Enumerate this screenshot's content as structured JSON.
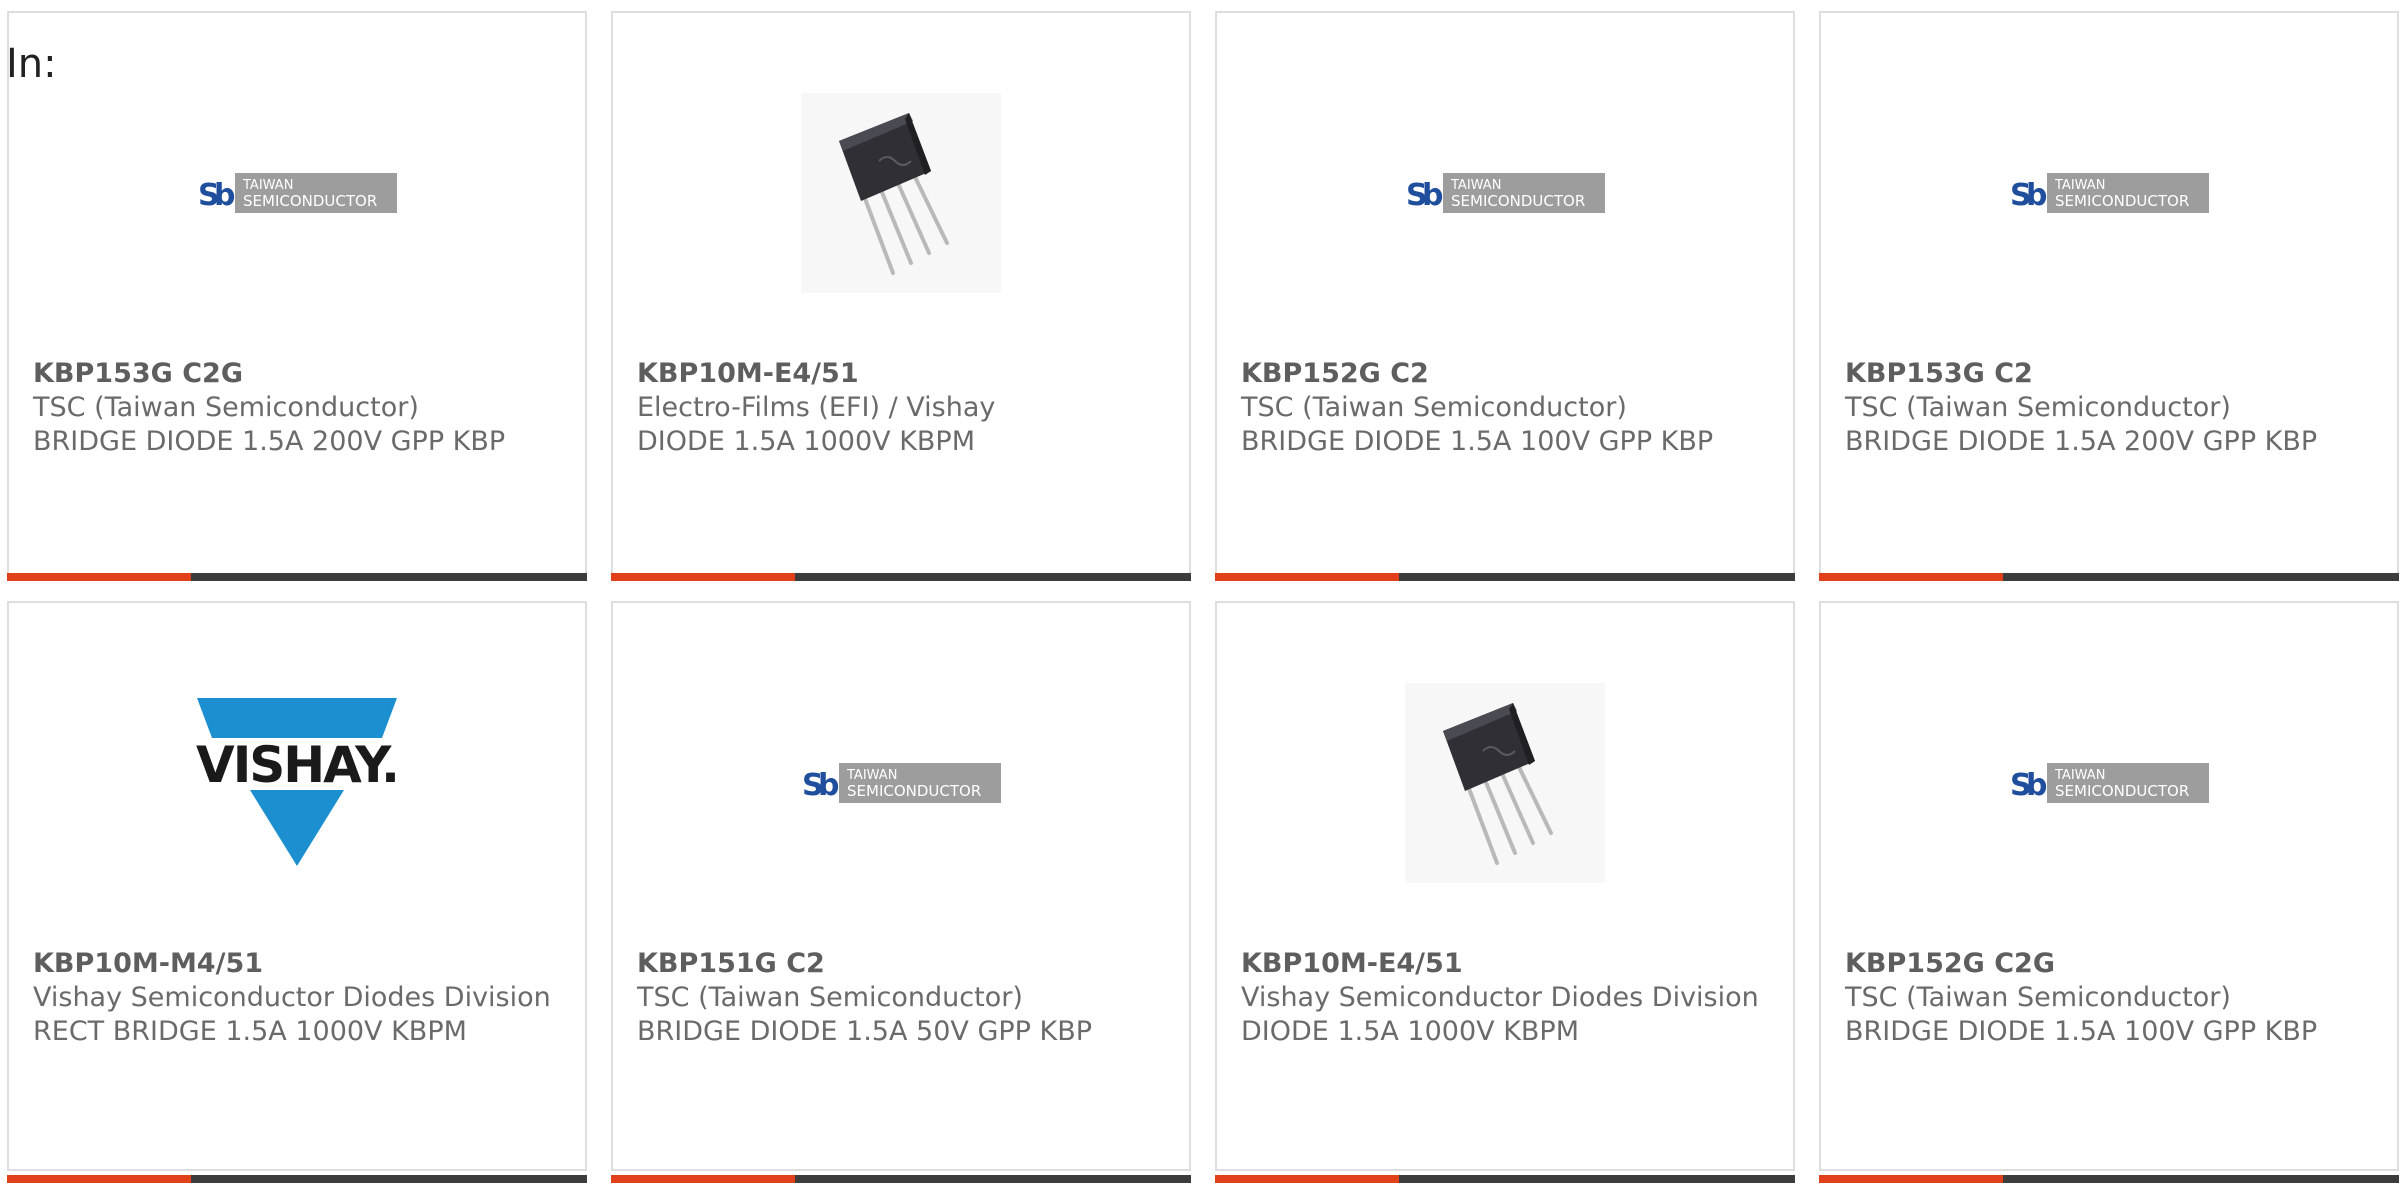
{
  "heading": "In:",
  "products": [
    {
      "part_number": "KBP153G C2G",
      "manufacturer": "TSC (Taiwan Semiconductor)",
      "description": "BRIDGE DIODE 1.5A 200V GPP KBP",
      "image": "taiwan-semiconductor-logo",
      "logo_text": [
        "TAIWAN",
        "SEMICONDUCTOR"
      ]
    },
    {
      "part_number": "KBP10M-E4/51",
      "manufacturer": "Electro-Films (EFI) / Vishay",
      "description": "DIODE 1.5A 1000V KBPM",
      "image": "bridge-rectifier-component-photo"
    },
    {
      "part_number": "KBP152G C2",
      "manufacturer": "TSC (Taiwan Semiconductor)",
      "description": "BRIDGE DIODE 1.5A 100V GPP KBP",
      "image": "taiwan-semiconductor-logo",
      "logo_text": [
        "TAIWAN",
        "SEMICONDUCTOR"
      ]
    },
    {
      "part_number": "KBP153G C2",
      "manufacturer": "TSC (Taiwan Semiconductor)",
      "description": "BRIDGE DIODE 1.5A 200V GPP KBP",
      "image": "taiwan-semiconductor-logo",
      "logo_text": [
        "TAIWAN",
        "SEMICONDUCTOR"
      ]
    },
    {
      "part_number": "KBP10M-M4/51",
      "manufacturer": "Vishay Semiconductor Diodes Division",
      "description": "RECT BRIDGE 1.5A 1000V KBPM",
      "image": "vishay-logo",
      "logo_text": [
        "VISHAY."
      ]
    },
    {
      "part_number": "KBP151G C2",
      "manufacturer": "TSC (Taiwan Semiconductor)",
      "description": "BRIDGE DIODE 1.5A 50V GPP KBP",
      "image": "taiwan-semiconductor-logo",
      "logo_text": [
        "TAIWAN",
        "SEMICONDUCTOR"
      ]
    },
    {
      "part_number": "KBP10M-E4/51",
      "manufacturer": "Vishay Semiconductor Diodes Division",
      "description": "DIODE 1.5A 1000V KBPM",
      "image": "bridge-rectifier-component-photo"
    },
    {
      "part_number": "KBP152G C2G",
      "manufacturer": "TSC (Taiwan Semiconductor)",
      "description": "BRIDGE DIODE 1.5A 100V GPP KBP",
      "image": "taiwan-semiconductor-logo",
      "logo_text": [
        "TAIWAN",
        "SEMICONDUCTOR"
      ]
    }
  ],
  "colors": {
    "accent_bar": "#e2401b",
    "dark_bar": "#3c3c3c",
    "card_border": "#dedede",
    "text": "#6a6a6a",
    "tsc_blue": "#1f4e9c",
    "tsc_grey": "#9d9d9d",
    "vishay_blue": "#1c8fd0"
  }
}
